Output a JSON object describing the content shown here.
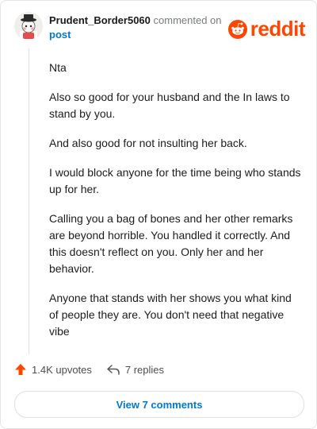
{
  "comment": {
    "username": "Prudent_Border5060",
    "action_text": "commented on",
    "post_link": "post",
    "paragraphs": [
      "Nta",
      "Also so good for your husband and the In laws to stand by you.",
      "And also good for not insulting her back.",
      "I would block anyone for the time being who stands up for her.",
      "Calling you a bag of bones and her other remarks are beyond horrible. You handled it correctly. And this doesn't reflect on you. Only her and her behavior.",
      "Anyone that stands with her shows you what kind of people they are. You don't need that negative vibe"
    ]
  },
  "logo": {
    "text": "reddit",
    "icon": "reddit-snoo-icon"
  },
  "actions": {
    "upvotes": "1.4K upvotes",
    "replies": "7 replies"
  },
  "view_button": "View 7 comments",
  "colors": {
    "brand": "#ff4500",
    "link": "#0079d3",
    "upvote": "#ff4500"
  }
}
